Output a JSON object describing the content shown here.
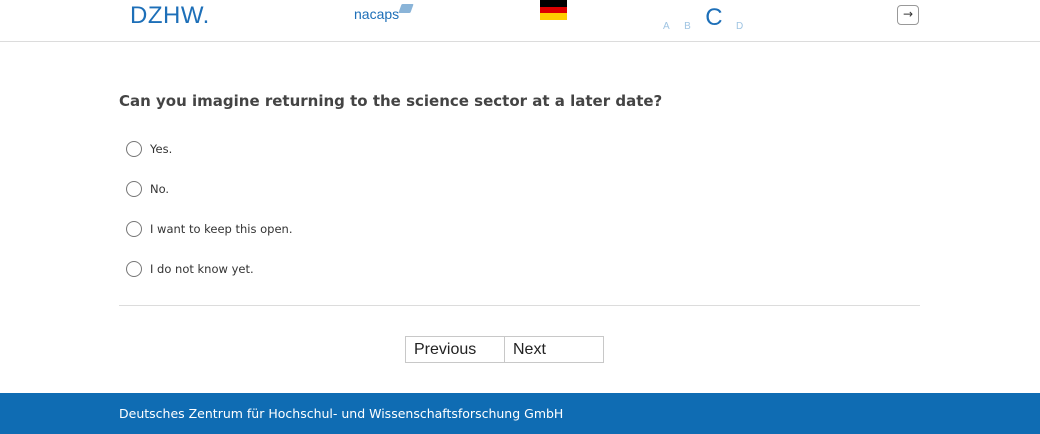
{
  "header": {
    "logo_dzhw": "DZHW.",
    "logo_nacaps": "nacaps",
    "language_flag": {
      "name": "german-flag",
      "colors": [
        "#000000",
        "#dd0000",
        "#ffce00"
      ]
    },
    "font_size_options": [
      "A",
      "B",
      "C",
      "D"
    ],
    "logout_icon": "→"
  },
  "question": {
    "text": "Can you imagine returning to the science sector at a later date?",
    "options": [
      {
        "label": "Yes.",
        "selected": false
      },
      {
        "label": "No.",
        "selected": false
      },
      {
        "label": "I want to keep this open.",
        "selected": false
      },
      {
        "label": "I do not know yet.",
        "selected": false
      }
    ]
  },
  "navigation": {
    "previous_label": "Previous",
    "next_label": "Next"
  },
  "footer": {
    "text": "Deutsches Zentrum für Hochschul- und Wissenschaftsforschung GmbH"
  },
  "colors": {
    "brand_blue": "#1d6fb8",
    "footer_blue": "#0f6cb3",
    "font_size_inactive": "#9fc4e2"
  }
}
